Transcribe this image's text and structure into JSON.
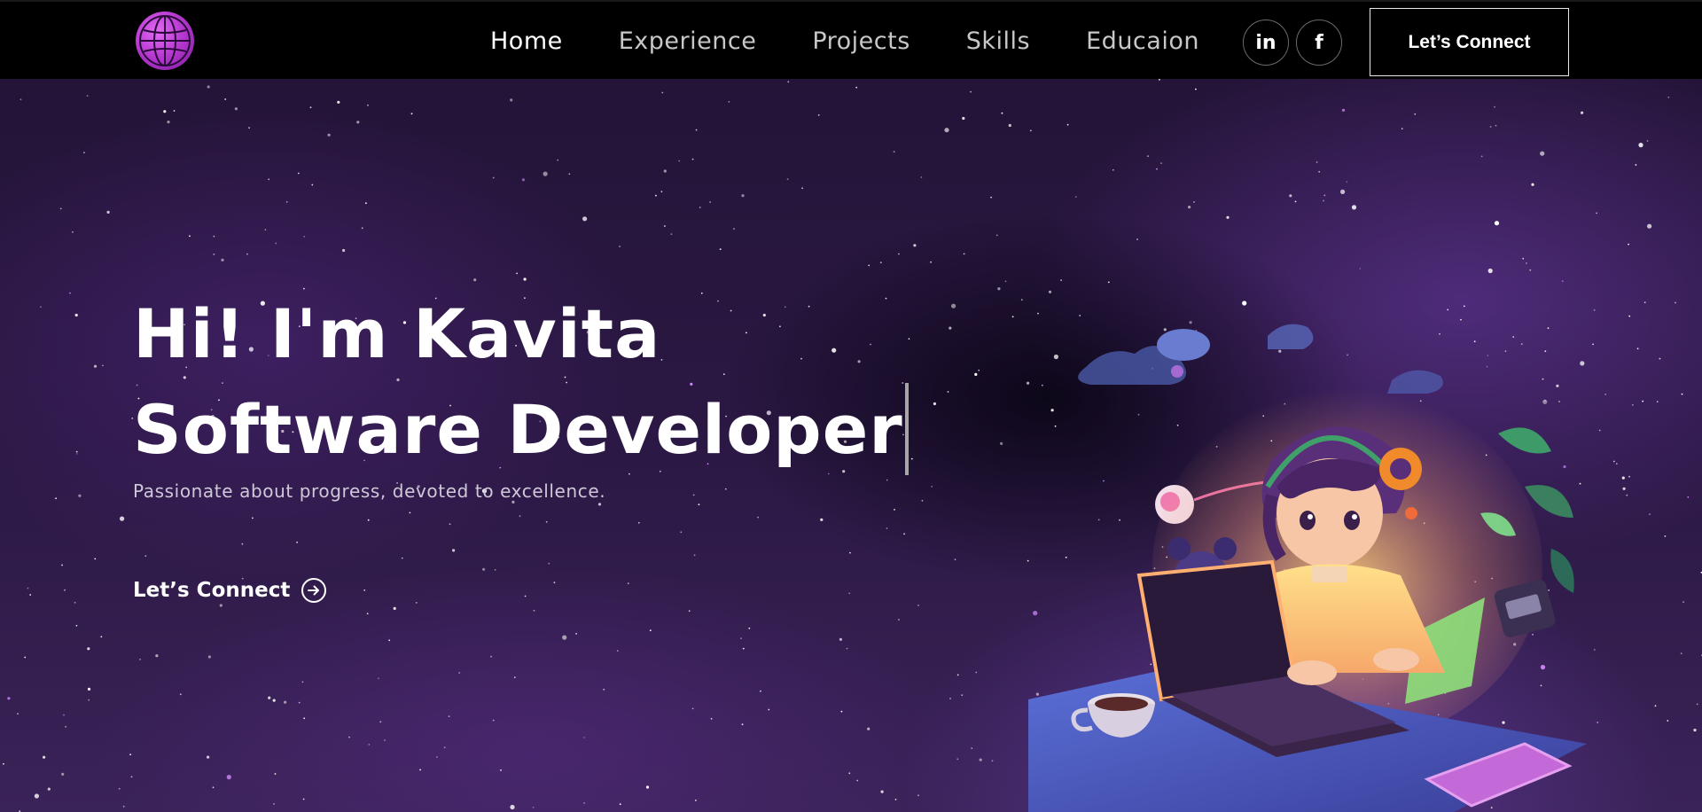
{
  "nav": {
    "logo_icon": "globe-icon",
    "links": [
      {
        "label": "Home",
        "active": true
      },
      {
        "label": "Experience",
        "active": false
      },
      {
        "label": "Projects",
        "active": false
      },
      {
        "label": "Skills",
        "active": false
      },
      {
        "label": "Educaion",
        "active": false
      }
    ],
    "social": [
      {
        "label": "in",
        "icon": "linkedin-icon"
      },
      {
        "label": "f",
        "icon": "facebook-icon"
      }
    ],
    "connect_label": "Let’s Connect"
  },
  "hero": {
    "greeting": "Hi! I'm Kavita",
    "role": "Software Developer",
    "tagline": "Passionate about progress, devoted to excellence.",
    "cta_label": "Let’s Connect",
    "cta_icon": "arrow-circle-right-icon",
    "illustration": "developer-astronaut-illustration"
  },
  "colors": {
    "nav_bg": "#000000",
    "hero_bg": "#2b1844",
    "accent": "#b93ad2",
    "text": "#ffffff"
  }
}
